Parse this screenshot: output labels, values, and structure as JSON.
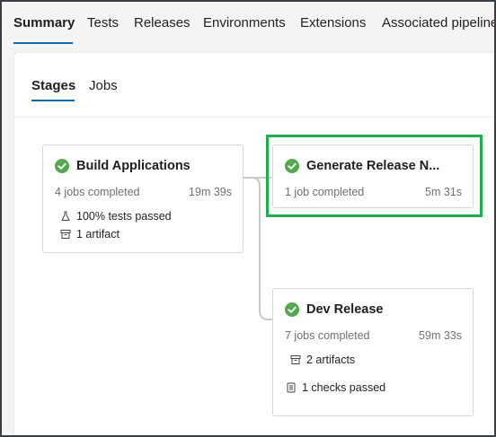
{
  "top_tabs": [
    {
      "label": "Summary",
      "active": true
    },
    {
      "label": "Tests",
      "active": false
    },
    {
      "label": "Releases",
      "active": false
    },
    {
      "label": "Environments",
      "active": false
    },
    {
      "label": "Extensions",
      "active": false
    },
    {
      "label": "Associated pipelines",
      "active": false
    }
  ],
  "sub_tabs": [
    {
      "label": "Stages",
      "active": true
    },
    {
      "label": "Jobs",
      "active": false
    }
  ],
  "stages": [
    {
      "title": "Build Applications",
      "status": "succeeded",
      "jobs": "4 jobs completed",
      "duration": "19m 39s",
      "details": [
        {
          "icon": "flask-icon",
          "text": "100% tests passed"
        },
        {
          "icon": "artifact-icon",
          "text": "1 artifact"
        }
      ]
    },
    {
      "title": "Generate Release N...",
      "status": "succeeded",
      "jobs": "1 job completed",
      "duration": "5m 31s",
      "details": []
    },
    {
      "title": "Dev Release",
      "status": "succeeded",
      "jobs": "7 jobs completed",
      "duration": "59m 33s",
      "details": [
        {
          "icon": "artifact-icon",
          "text": "2 artifacts"
        },
        {
          "icon": "checklist-icon",
          "text": "1 checks passed"
        }
      ]
    }
  ],
  "colors": {
    "accent": "#0f6cbd",
    "success": "#54a850",
    "highlight": "#1fad4b"
  }
}
